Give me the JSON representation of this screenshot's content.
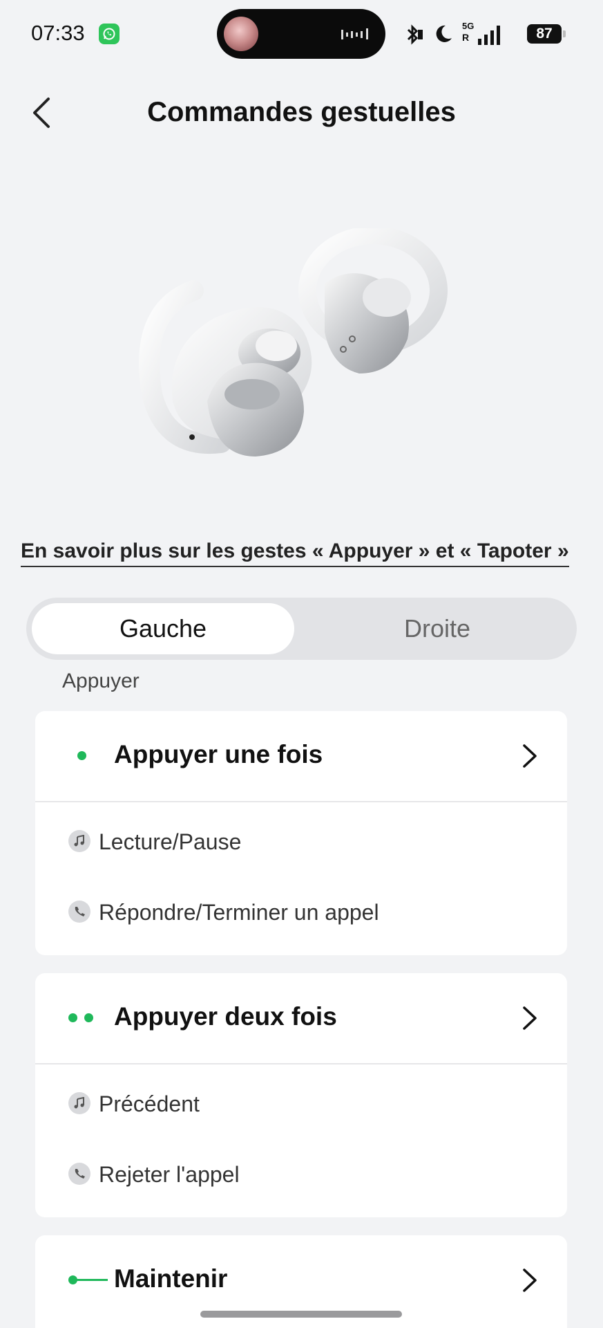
{
  "status_bar": {
    "time": "07:33",
    "battery": "87",
    "network": "5G",
    "roaming": "R",
    "icons": [
      "whatsapp-icon",
      "bluetooth-icon",
      "moon-icon",
      "signal-icon",
      "battery-icon"
    ]
  },
  "header": {
    "title": "Commandes gestuelles"
  },
  "learn_more_link": "En savoir plus sur les gestes « Appuyer » et « Tapoter »",
  "tabs": {
    "left": "Gauche",
    "right": "Droite",
    "selected": "Gauche"
  },
  "section_label": "Appuyer",
  "cards": [
    {
      "title": "Appuyer une fois",
      "rows": [
        {
          "icon": "music-note-icon",
          "label": "Lecture/Pause"
        },
        {
          "icon": "phone-icon",
          "label": "Répondre/Terminer un appel"
        }
      ]
    },
    {
      "title": "Appuyer deux fois",
      "rows": [
        {
          "icon": "music-note-icon",
          "label": "Précédent"
        },
        {
          "icon": "phone-icon",
          "label": "Rejeter l'appel"
        }
      ]
    },
    {
      "title": "Maintenir"
    }
  ],
  "colors": {
    "accent": "#1fb85a",
    "background": "#f2f3f5"
  }
}
